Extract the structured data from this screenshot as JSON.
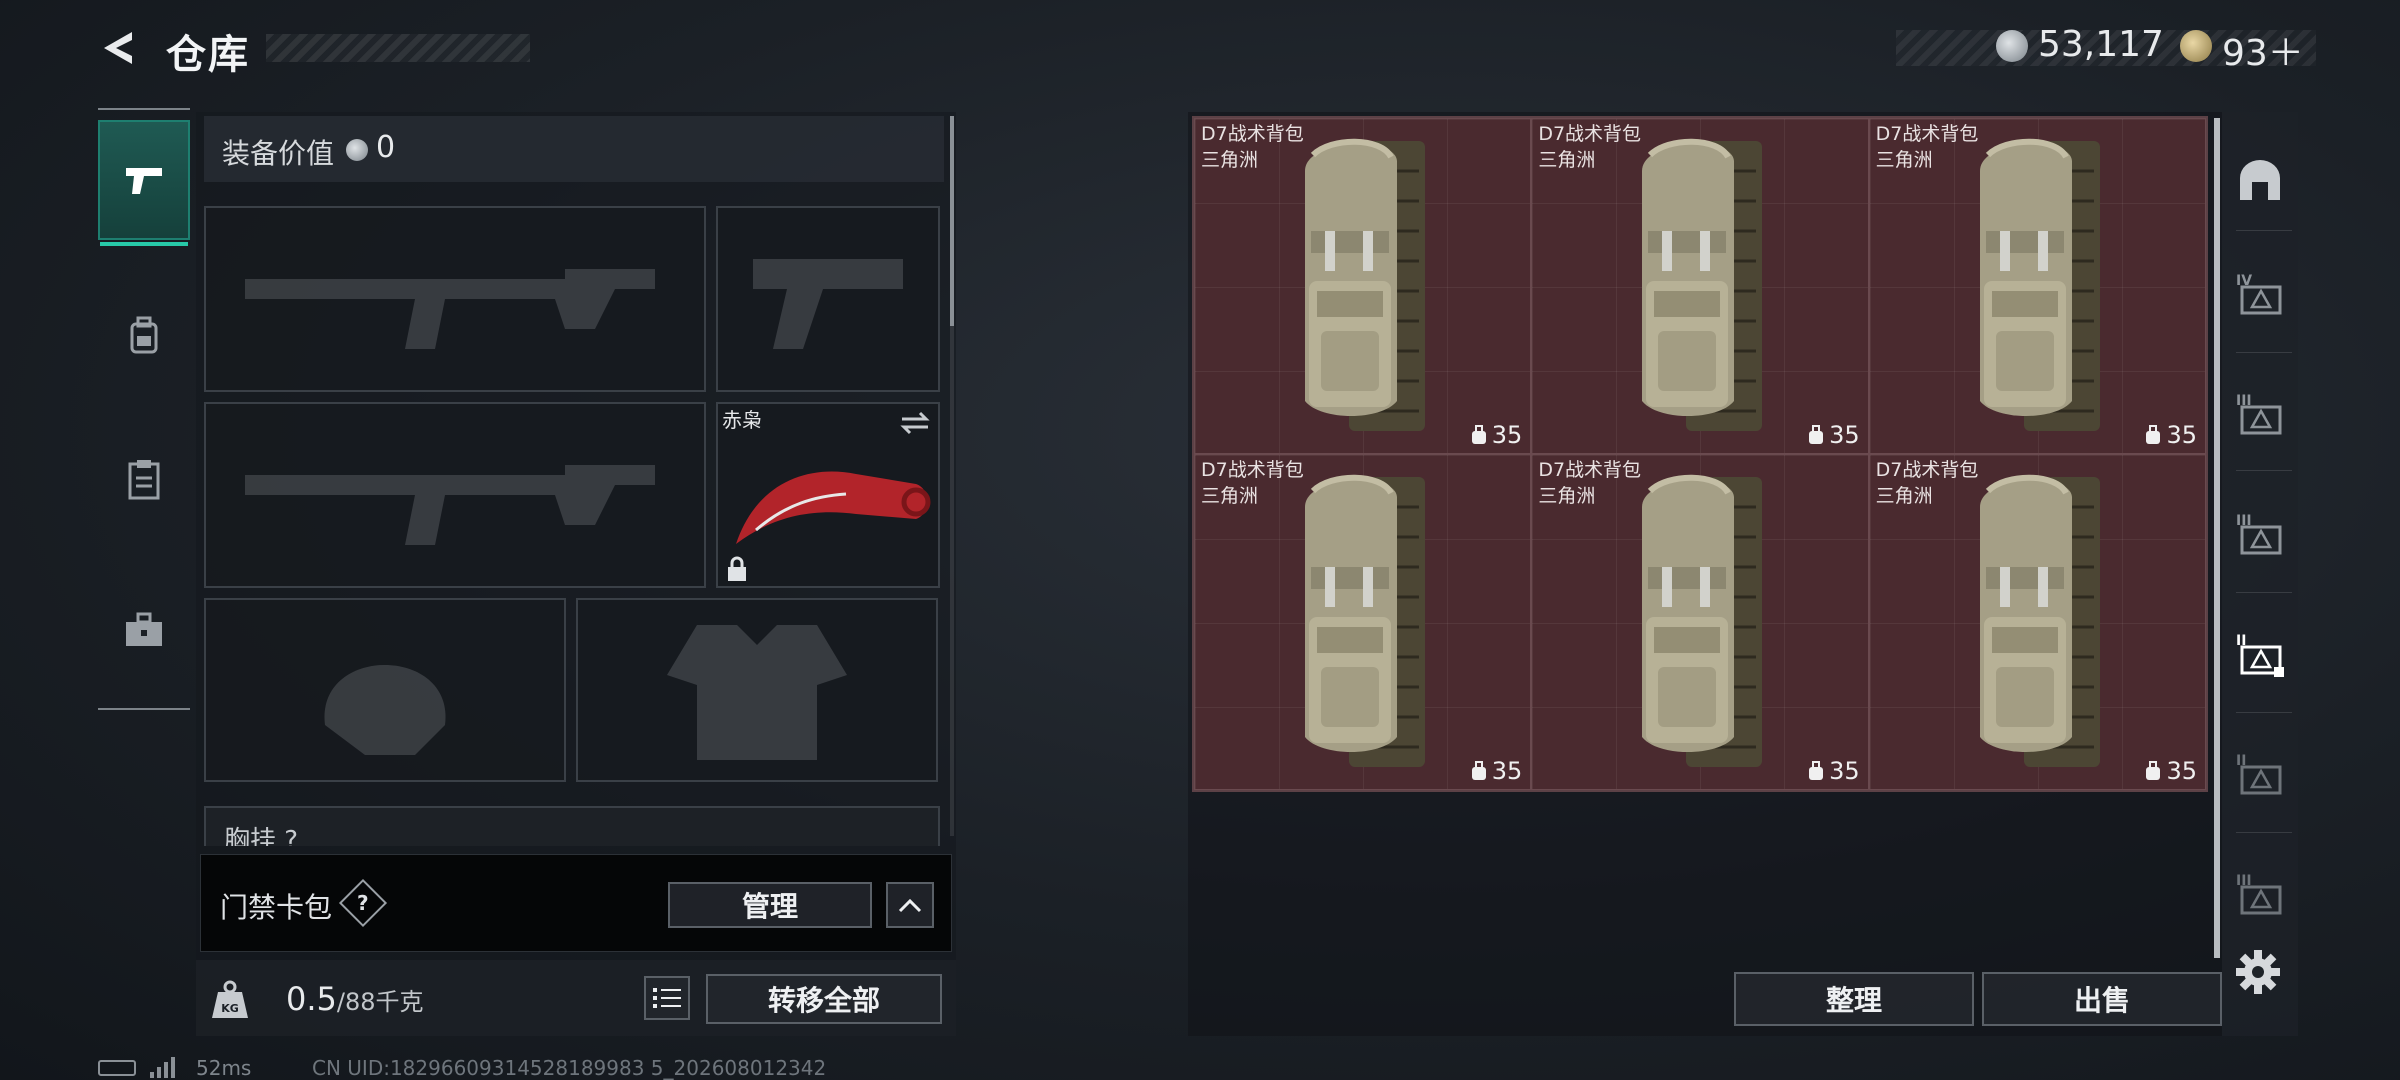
{
  "header": {
    "title": "仓库",
    "currency": [
      {
        "type": "silver-coin-icon",
        "amount": "53,117"
      },
      {
        "type": "gold-coin-icon",
        "amount": "93＋"
      }
    ]
  },
  "left_rail": {
    "tabs": [
      {
        "icon": "pistol-icon",
        "active": true
      },
      {
        "icon": "backpack-icon",
        "active": false
      },
      {
        "icon": "clipboard-icon",
        "active": false
      },
      {
        "icon": "briefcase-icon",
        "active": false
      }
    ]
  },
  "equipment": {
    "value_label": "装备价值",
    "value": "0",
    "slots": {
      "primary_weapon": {
        "icon": "rifle-icon"
      },
      "pistol": {
        "icon": "pistol-icon"
      },
      "secondary_weapon": {
        "icon": "rifle-icon"
      },
      "melee": {
        "name": "赤枭",
        "icon": "karambit-knife-icon",
        "locked": true
      },
      "helmet": {
        "icon": "helmet-icon"
      },
      "armor": {
        "icon": "armor-vest-icon"
      }
    },
    "chest_rig_label": "胸挂 ?"
  },
  "keycard": {
    "label": "门禁卡包",
    "help": "?",
    "manage_label": "管理"
  },
  "weight": {
    "current": "0.5",
    "max": "/88千克",
    "transfer_label": "转移全部"
  },
  "stash": {
    "items": [
      {
        "name": "D7战术背包",
        "tag": "三角洲",
        "capacity": "35"
      },
      {
        "name": "D7战术背包",
        "tag": "三角洲",
        "capacity": "35"
      },
      {
        "name": "D7战术背包",
        "tag": "三角洲",
        "capacity": "35"
      },
      {
        "name": "D7战术背包",
        "tag": "三角洲",
        "capacity": "35"
      },
      {
        "name": "D7战术背包",
        "tag": "三角洲",
        "capacity": "35"
      },
      {
        "name": "D7战术背包",
        "tag": "三角洲",
        "capacity": "35"
      }
    ],
    "sort_label": "整理",
    "sell_label": "出售",
    "cell_color": "#4a2a2f"
  },
  "right_rail": {
    "items": [
      "arch-icon",
      "storage-iv-icon",
      "storage-iii-icon",
      "storage-iii-alt-icon",
      "storage-ii-icon",
      "storage-ii-alt-icon",
      "storage-i-icon"
    ]
  },
  "footer": {
    "ping": "52ms",
    "uid": "CN UID:18296609314528189983 5_202608012342"
  }
}
